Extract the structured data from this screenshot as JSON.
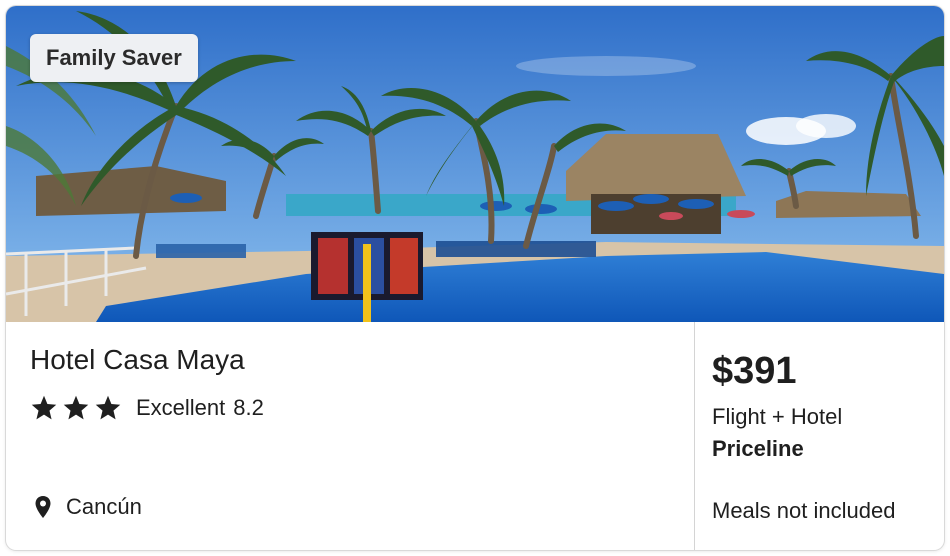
{
  "badge": {
    "label": "Family Saver"
  },
  "hotel": {
    "name": "Hotel Casa Maya",
    "star_count": 3,
    "rating_word": "Excellent",
    "rating_score": "8.2",
    "location": "Cancún"
  },
  "offer": {
    "price": "$391",
    "package": "Flight + Hotel",
    "provider": "Priceline",
    "meals": "Meals not included"
  },
  "icons": {
    "star": "star-icon",
    "location": "map-pin-icon"
  },
  "colors": {
    "text": "#1f1f1f",
    "badge_bg": "#eef0f3",
    "divider": "#d4d4d4"
  }
}
